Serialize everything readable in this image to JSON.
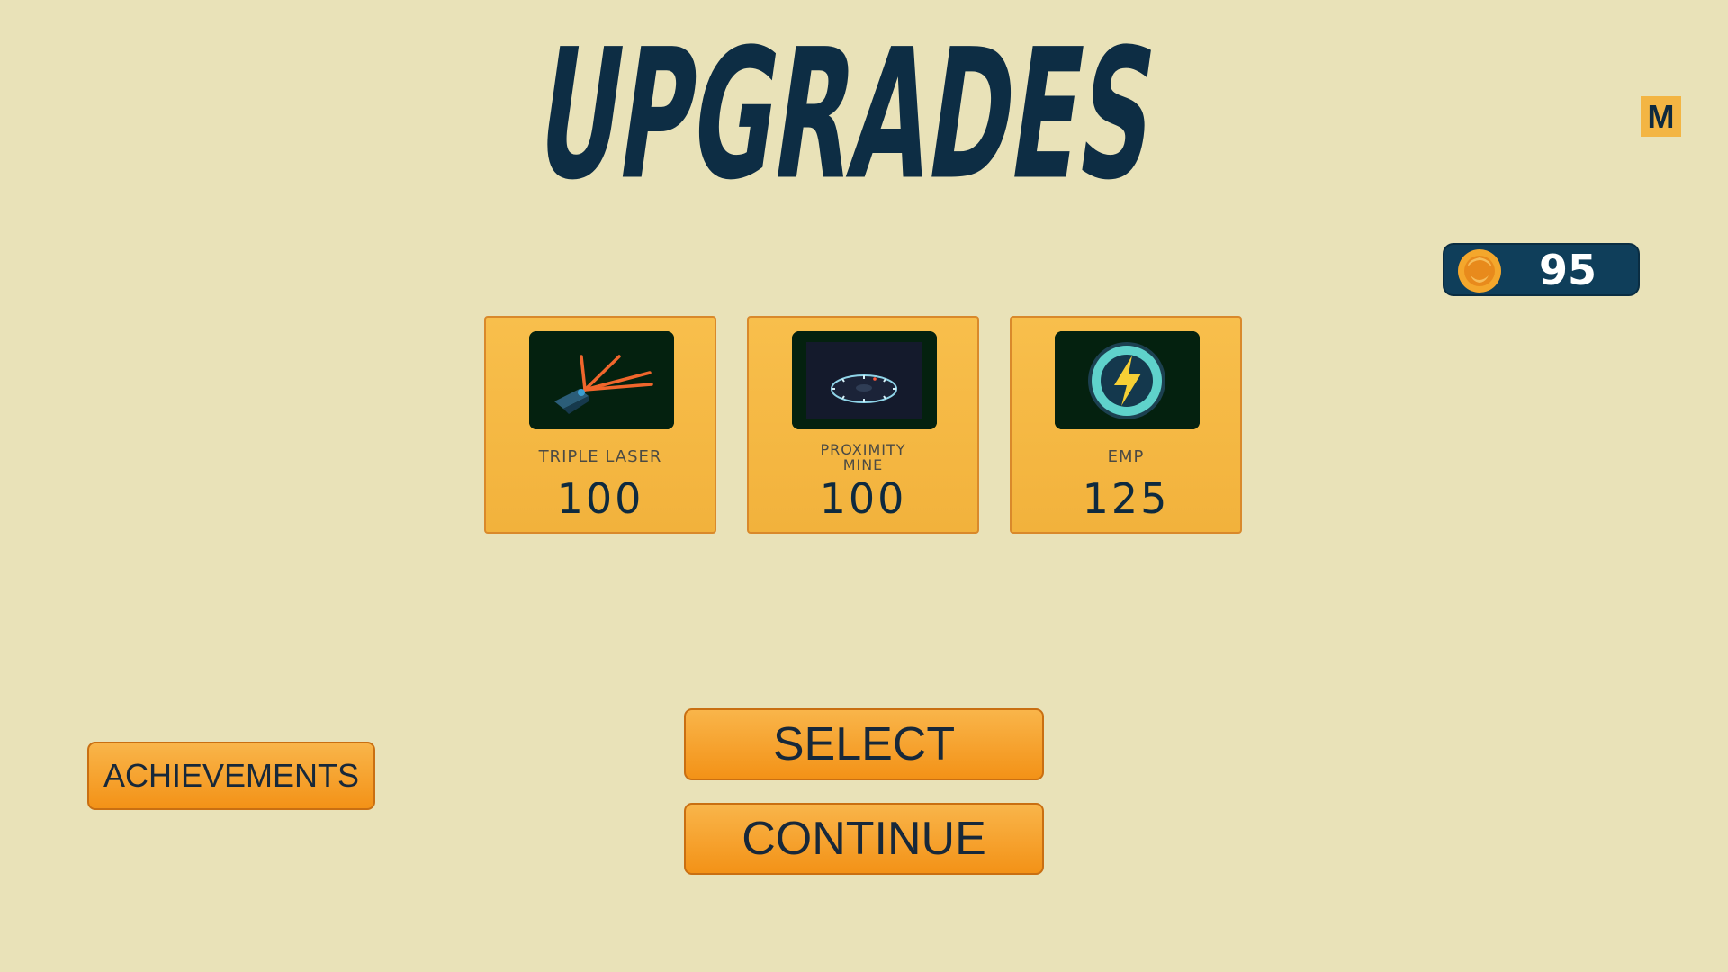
{
  "screen": {
    "title": "UPGRADES",
    "mute_label": "M"
  },
  "wallet": {
    "coins": "95",
    "icon": "coin-icon"
  },
  "upgrades": [
    {
      "name": "TRIPLE LASER",
      "name_line1": "TRIPLE LASER",
      "name_line2": "",
      "price": "100",
      "icon": "triple-laser-icon"
    },
    {
      "name": "PROXIMITY MINE",
      "name_line1": "PROXIMITY",
      "name_line2": "MINE",
      "price": "100",
      "icon": "proximity-mine-icon"
    },
    {
      "name": "EMP",
      "name_line1": "EMP",
      "name_line2": "",
      "price": "125",
      "icon": "emp-icon"
    }
  ],
  "buttons": {
    "select_label": "SELECT",
    "continue_label": "CONTINUE",
    "achievements_label": "ACHIEVEMENTS"
  },
  "colors": {
    "background": "#e9e2b8",
    "title": "#0d2d44",
    "card": "#f5b841",
    "button": "#f5a229",
    "coin_panel": "#0f3e5a"
  }
}
